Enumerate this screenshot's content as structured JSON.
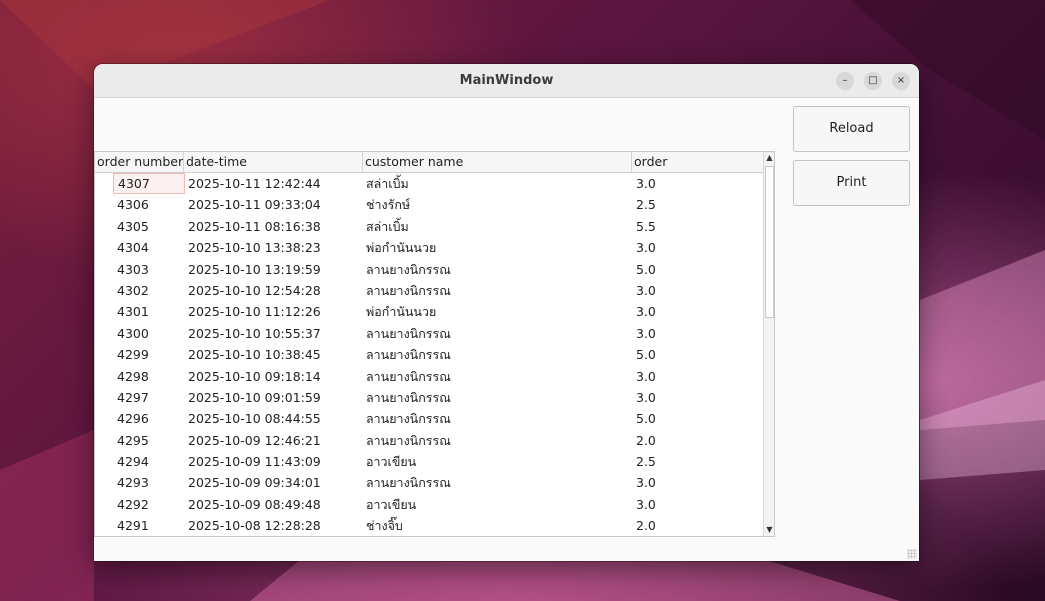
{
  "window": {
    "title": "MainWindow",
    "controls": {
      "minimize": "–",
      "maximize": "□",
      "close": "×"
    }
  },
  "buttons": {
    "reload": "Reload",
    "print": "Print"
  },
  "table": {
    "columns": [
      "order number",
      "date-time",
      "customer name",
      "order"
    ],
    "rows": [
      [
        "4307",
        "2025-10-11 12:42:44",
        "สล่าเบิ้ม",
        "3.0"
      ],
      [
        "4306",
        "2025-10-11 09:33:04",
        "ช่างรักษ์",
        "2.5"
      ],
      [
        "4305",
        "2025-10-11 08:16:38",
        "สล่าเบิ้ม",
        "5.5"
      ],
      [
        "4304",
        "2025-10-10 13:38:23",
        "พ่อกำนันนวย",
        "3.0"
      ],
      [
        "4303",
        "2025-10-10 13:19:59",
        "ลานยางนิกรรณ",
        "5.0"
      ],
      [
        "4302",
        "2025-10-10 12:54:28",
        "ลานยางนิกรรณ",
        "3.0"
      ],
      [
        "4301",
        "2025-10-10 11:12:26",
        "พ่อกำนันนวย",
        "3.0"
      ],
      [
        "4300",
        "2025-10-10 10:55:37",
        "ลานยางนิกรรณ",
        "3.0"
      ],
      [
        "4299",
        "2025-10-10 10:38:45",
        "ลานยางนิกรรณ",
        "5.0"
      ],
      [
        "4298",
        "2025-10-10 09:18:14",
        "ลานยางนิกรรณ",
        "3.0"
      ],
      [
        "4297",
        "2025-10-10 09:01:59",
        "ลานยางนิกรรณ",
        "3.0"
      ],
      [
        "4296",
        "2025-10-10 08:44:55",
        "ลานยางนิกรรณ",
        "5.0"
      ],
      [
        "4295",
        "2025-10-09 12:46:21",
        "ลานยางนิกรรณ",
        "2.0"
      ],
      [
        "4294",
        "2025-10-09 11:43:09",
        "อาวเขียน",
        "2.5"
      ],
      [
        "4293",
        "2025-10-09 09:34:01",
        "ลานยางนิกรรณ",
        "3.0"
      ],
      [
        "4292",
        "2025-10-09 08:49:48",
        "อาวเขียน",
        "3.0"
      ],
      [
        "4291",
        "2025-10-08 12:28:28",
        "ช่างจิ๊บ",
        "2.0"
      ]
    ],
    "selected_row": 0
  },
  "scrollbar": {
    "up_arrow": "▲",
    "down_arrow": "▼"
  },
  "colors": {
    "selected_cell_bg": "#fdf0f0",
    "selected_cell_border": "#f0b8b8",
    "titlebar_bg": "#ebebeb"
  }
}
